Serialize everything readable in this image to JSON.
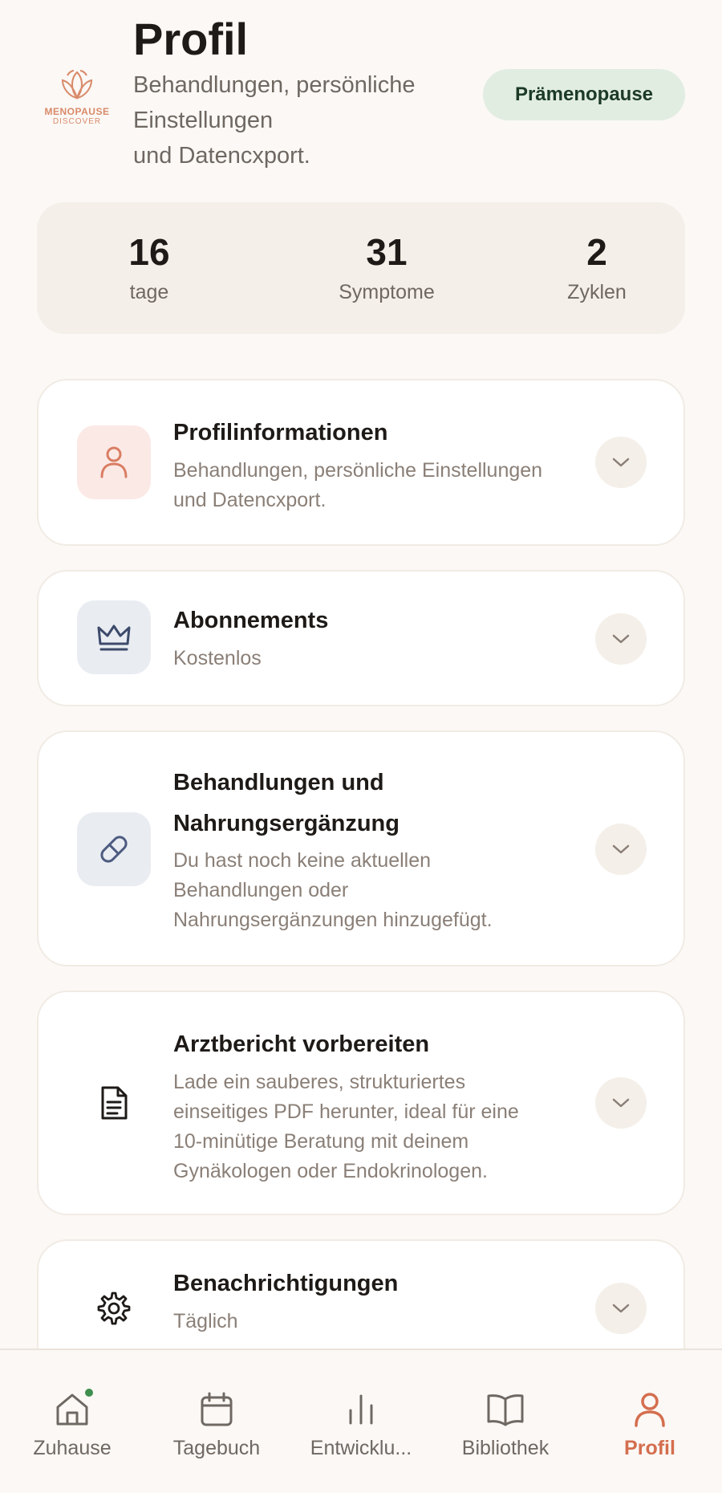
{
  "header": {
    "title": "Profil",
    "subtitle_line1": "Behandlungen, persönliche",
    "subtitle_line2": "Einstellungen",
    "subtitle_line3": "und Datencxport.",
    "logo_line1": "MENOPAUSE",
    "logo_line2": "DISCOVER",
    "phase_badge": "Prämenopause"
  },
  "stats": [
    {
      "value": "16",
      "label": "tage"
    },
    {
      "value": "31",
      "label": "Symptome"
    },
    {
      "value": "2",
      "label": "Zyklen"
    }
  ],
  "cards": {
    "profile": {
      "title": "Profilinformationen",
      "desc_line1": "Behandlungen, persönliche Einstellungen",
      "desc_line2": "und Datencxport.",
      "icon": "user-icon"
    },
    "subscription": {
      "title": "Abonnements",
      "desc": "Kostenlos",
      "icon": "crown-icon"
    },
    "treatments": {
      "title_line1": "Behandlungen und",
      "title_line2": "Nahrungsergänzung",
      "desc_line1": "Du hast noch keine aktuellen",
      "desc_line2": "Behandlungen oder",
      "desc_line3": "Nahrungsergänzungen hinzugefügt.",
      "icon": "pill-icon"
    },
    "report": {
      "title": "Arztbericht vorbereiten",
      "desc_line1": "Lade ein sauberes, strukturiertes",
      "desc_line2": "einseitiges PDF herunter, ideal für eine",
      "desc_line3": "10-minütige Beratung mit deinem",
      "desc_line4": "Gynäkologen oder Endokrinologen.",
      "icon": "document-icon"
    },
    "notifications": {
      "title": "Benachrichtigungen",
      "desc": "Täglich",
      "icon": "gear-icon"
    }
  },
  "nav": [
    {
      "label": "Zuhause",
      "icon": "home-icon"
    },
    {
      "label": "Tagebuch",
      "icon": "calendar-icon"
    },
    {
      "label": "Entwicklu...",
      "icon": "bar-chart-icon"
    },
    {
      "label": "Bibliothek",
      "icon": "book-icon"
    },
    {
      "label": "Profil",
      "icon": "profile-icon",
      "active": true
    }
  ],
  "colors": {
    "background": "#fbf8f5",
    "accent": "#d46e4f",
    "badge_bg": "#e2ede2",
    "notification_dot": "#3f8f4f"
  }
}
